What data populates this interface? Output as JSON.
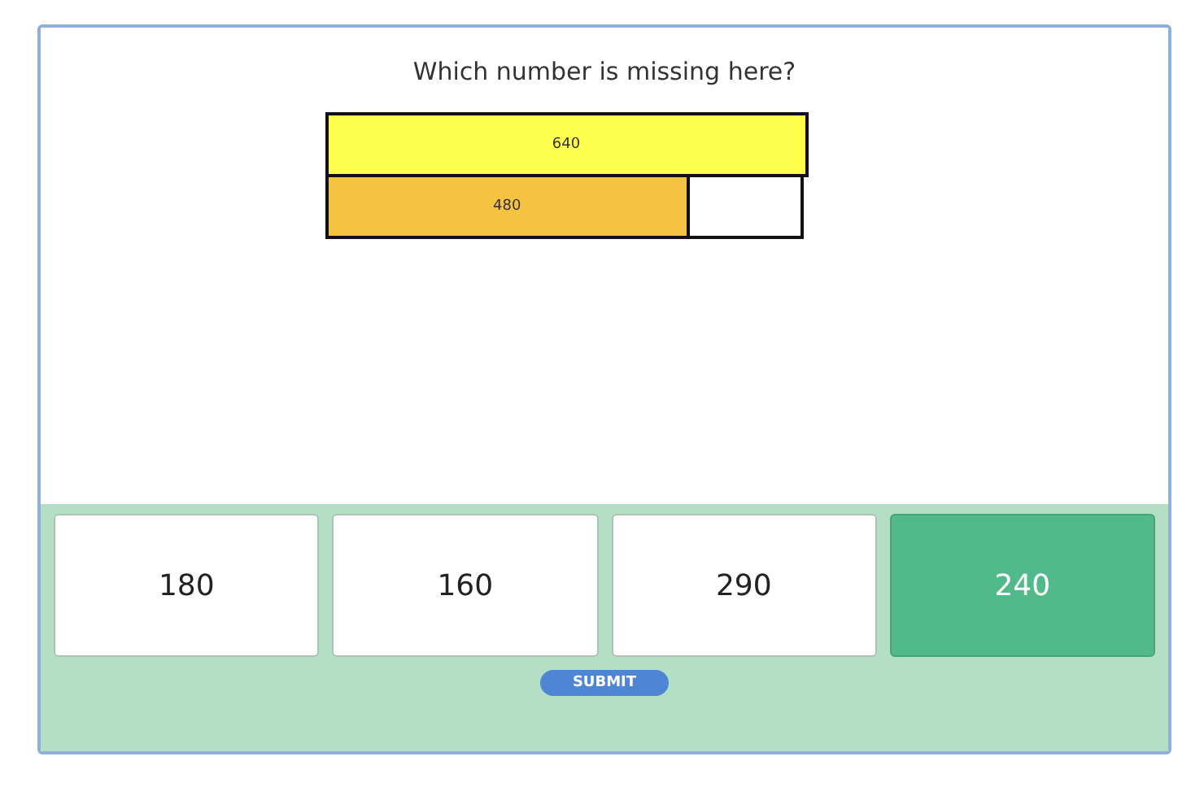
{
  "question": "Which number is missing here?",
  "bar_model": {
    "rows": [
      {
        "segments": [
          {
            "kind": "value",
            "label": "640",
            "level": 1,
            "color": "#ffff4d"
          }
        ]
      },
      {
        "segments": [
          {
            "kind": "value",
            "label": "480",
            "level": 0.755,
            "color": "#f5c242"
          },
          {
            "kind": "blank",
            "level": 0.245
          }
        ]
      }
    ]
  },
  "options": [
    {
      "label": "180",
      "selected": false
    },
    {
      "label": "160",
      "selected": false
    },
    {
      "label": "290",
      "selected": false
    },
    {
      "label": "240",
      "selected": true
    }
  ],
  "submit_button": "SUBMIT"
}
